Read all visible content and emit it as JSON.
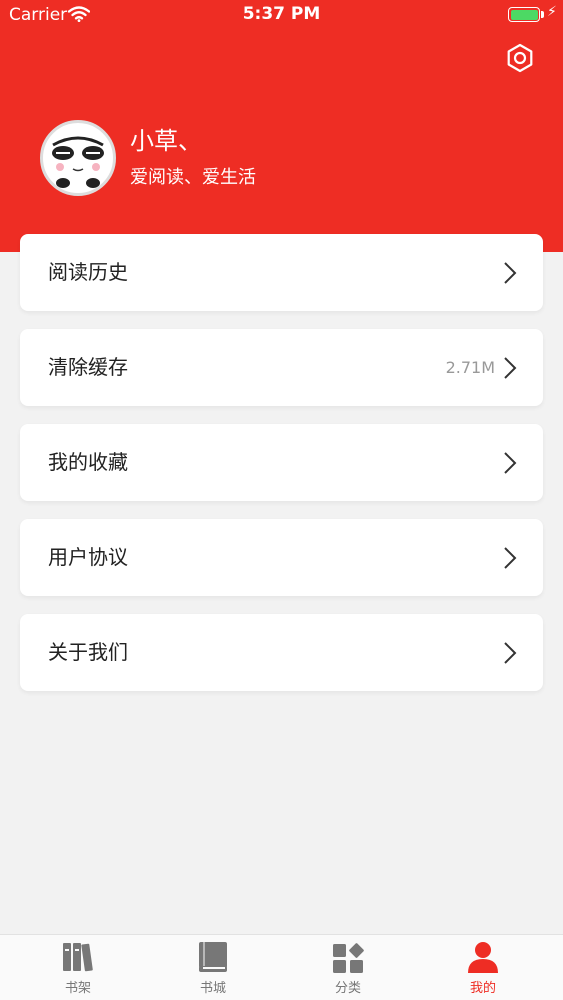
{
  "status_bar": {
    "carrier": "Carrier",
    "time": "5:37 PM"
  },
  "profile": {
    "username": "小草、",
    "motto": "爱阅读、爱生活"
  },
  "menu": [
    {
      "label": "阅读历史",
      "value": ""
    },
    {
      "label": "清除缓存",
      "value": "2.71M"
    },
    {
      "label": "我的收藏",
      "value": ""
    },
    {
      "label": "用户协议",
      "value": ""
    },
    {
      "label": "关于我们",
      "value": ""
    }
  ],
  "tabbar": [
    {
      "label": "书架",
      "icon": "bookshelf-icon",
      "active": false
    },
    {
      "label": "书城",
      "icon": "book-icon",
      "active": false
    },
    {
      "label": "分类",
      "icon": "category-icon",
      "active": false
    },
    {
      "label": "我的",
      "icon": "person-icon",
      "active": true
    }
  ],
  "colors": {
    "accent": "#ee2d24",
    "background": "#f2f2f2",
    "battery": "#4cd964"
  }
}
